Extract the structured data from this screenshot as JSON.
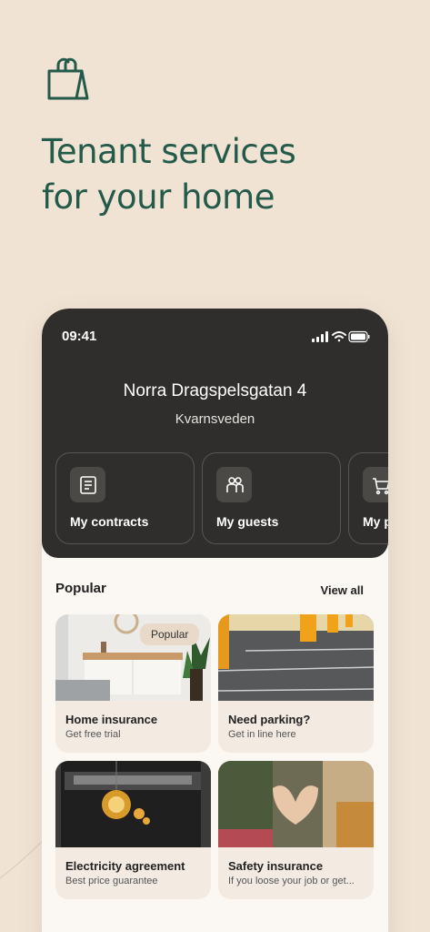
{
  "hero": {
    "title_line1": "Tenant services",
    "title_line2": "for your home",
    "icon": "shopping-bag-icon"
  },
  "phone": {
    "status": {
      "time": "09:41"
    },
    "address": "Norra Dragspelsgatan 4",
    "city": "Kvarnsveden",
    "quick_actions": [
      {
        "label": "My contracts",
        "icon": "document-icon"
      },
      {
        "label": "My guests",
        "icon": "guests-icon"
      },
      {
        "label": "My p",
        "icon": "cart-icon"
      }
    ],
    "popular": {
      "title": "Popular",
      "view_all": "View all",
      "cards": [
        {
          "title": "Home insurance",
          "subtitle": "Get free trial",
          "badge": "Popular"
        },
        {
          "title": "Need parking?",
          "subtitle": "Get in line here"
        },
        {
          "title": "Electricity agreement",
          "subtitle": "Best price guarantee"
        },
        {
          "title": "Safety insurance",
          "subtitle": "If you loose your job or get..."
        }
      ]
    }
  },
  "colors": {
    "background": "#f0e3d3",
    "brand_green": "#245a4a",
    "dark_header": "#2f2e2c",
    "card_bg": "#f3ebe2"
  }
}
